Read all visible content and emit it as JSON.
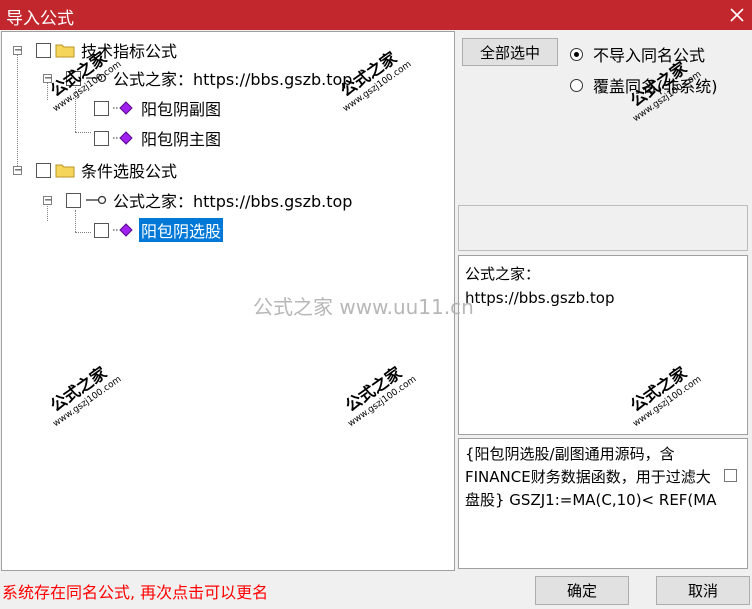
{
  "window": {
    "title": "导入公式"
  },
  "tree": {
    "items": [
      {
        "label": "技术指标公式"
      },
      {
        "label": "公式之家：https://bbs.gszb.top"
      },
      {
        "label": "阳包阴副图"
      },
      {
        "label": "阳包阴主图"
      },
      {
        "label": "条件选股公式"
      },
      {
        "label": "公式之家：https://bbs.gszb.top"
      },
      {
        "label": "阳包阴选股"
      }
    ]
  },
  "options": {
    "select_all": "全部选中",
    "no_import": "不导入同名公式",
    "overwrite": "覆盖同名(非系统)"
  },
  "description": {
    "line1": "公式之家：",
    "line2": "https://bbs.gszb.top"
  },
  "code": {
    "text": "{阳包阴选股/副图通用源码，含FINANCE财务数据函数，用于过滤大盘股} GSZJ1:=MA(C,10)< REF(MA"
  },
  "status": {
    "text": "系统存在同名公式, 再次点击可以更名"
  },
  "buttons": {
    "ok": "确定",
    "cancel": "取消"
  },
  "watermarks": {
    "center": "公式之家 www.uu11.cn",
    "stamp_cn": "公式之家",
    "stamp_url": "www.gszj100.com"
  }
}
